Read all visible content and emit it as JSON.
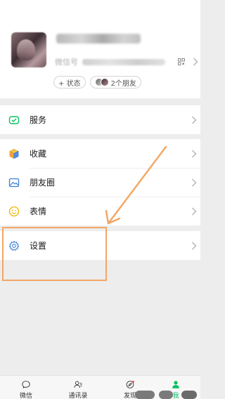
{
  "profile": {
    "wxid_label": "微信号",
    "status_button": "+ 状态",
    "friends_label": "2个朋友"
  },
  "menu": {
    "services": "服务",
    "favorites": "收藏",
    "moments": "朋友圈",
    "stickers": "表情",
    "settings": "设置"
  },
  "tabbar": {
    "chats": "微信",
    "contacts": "通讯录",
    "discover": "发现",
    "me": "我"
  },
  "colors": {
    "annotation": "#f2a663",
    "wechat_green": "#07c160",
    "background": "#ededed"
  }
}
